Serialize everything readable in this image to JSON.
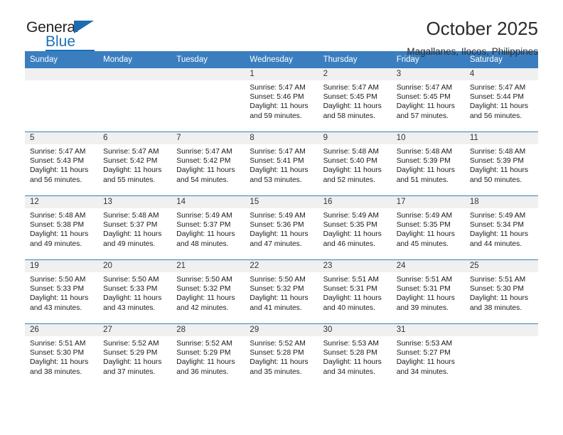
{
  "logo": {
    "word_top": "General",
    "word_bottom": "Blue",
    "triangle_color": "#1d6cb2",
    "text_color": "#231f20",
    "blue_color": "#1d70b8"
  },
  "header": {
    "title": "October 2025",
    "subtitle": "Magallanes, Ilocos, Philippines"
  },
  "theme": {
    "header_bg": "#3a7ebf",
    "header_text": "#ffffff",
    "daynum_bg": "#f0f0f0",
    "cell_bg": "#ffffff",
    "rule_color": "#3a7ebf"
  },
  "weekday_headers": [
    "Sunday",
    "Monday",
    "Tuesday",
    "Wednesday",
    "Thursday",
    "Friday",
    "Saturday"
  ],
  "weeks": [
    [
      {
        "day": "",
        "sunrise": "",
        "sunset": "",
        "daylight": "",
        "empty": true
      },
      {
        "day": "",
        "sunrise": "",
        "sunset": "",
        "daylight": "",
        "empty": true
      },
      {
        "day": "",
        "sunrise": "",
        "sunset": "",
        "daylight": "",
        "empty": true
      },
      {
        "day": "1",
        "sunrise": "Sunrise: 5:47 AM",
        "sunset": "Sunset: 5:46 PM",
        "daylight": "Daylight: 11 hours and 59 minutes."
      },
      {
        "day": "2",
        "sunrise": "Sunrise: 5:47 AM",
        "sunset": "Sunset: 5:45 PM",
        "daylight": "Daylight: 11 hours and 58 minutes."
      },
      {
        "day": "3",
        "sunrise": "Sunrise: 5:47 AM",
        "sunset": "Sunset: 5:45 PM",
        "daylight": "Daylight: 11 hours and 57 minutes."
      },
      {
        "day": "4",
        "sunrise": "Sunrise: 5:47 AM",
        "sunset": "Sunset: 5:44 PM",
        "daylight": "Daylight: 11 hours and 56 minutes."
      }
    ],
    [
      {
        "day": "5",
        "sunrise": "Sunrise: 5:47 AM",
        "sunset": "Sunset: 5:43 PM",
        "daylight": "Daylight: 11 hours and 56 minutes."
      },
      {
        "day": "6",
        "sunrise": "Sunrise: 5:47 AM",
        "sunset": "Sunset: 5:42 PM",
        "daylight": "Daylight: 11 hours and 55 minutes."
      },
      {
        "day": "7",
        "sunrise": "Sunrise: 5:47 AM",
        "sunset": "Sunset: 5:42 PM",
        "daylight": "Daylight: 11 hours and 54 minutes."
      },
      {
        "day": "8",
        "sunrise": "Sunrise: 5:47 AM",
        "sunset": "Sunset: 5:41 PM",
        "daylight": "Daylight: 11 hours and 53 minutes."
      },
      {
        "day": "9",
        "sunrise": "Sunrise: 5:48 AM",
        "sunset": "Sunset: 5:40 PM",
        "daylight": "Daylight: 11 hours and 52 minutes."
      },
      {
        "day": "10",
        "sunrise": "Sunrise: 5:48 AM",
        "sunset": "Sunset: 5:39 PM",
        "daylight": "Daylight: 11 hours and 51 minutes."
      },
      {
        "day": "11",
        "sunrise": "Sunrise: 5:48 AM",
        "sunset": "Sunset: 5:39 PM",
        "daylight": "Daylight: 11 hours and 50 minutes."
      }
    ],
    [
      {
        "day": "12",
        "sunrise": "Sunrise: 5:48 AM",
        "sunset": "Sunset: 5:38 PM",
        "daylight": "Daylight: 11 hours and 49 minutes."
      },
      {
        "day": "13",
        "sunrise": "Sunrise: 5:48 AM",
        "sunset": "Sunset: 5:37 PM",
        "daylight": "Daylight: 11 hours and 49 minutes."
      },
      {
        "day": "14",
        "sunrise": "Sunrise: 5:49 AM",
        "sunset": "Sunset: 5:37 PM",
        "daylight": "Daylight: 11 hours and 48 minutes."
      },
      {
        "day": "15",
        "sunrise": "Sunrise: 5:49 AM",
        "sunset": "Sunset: 5:36 PM",
        "daylight": "Daylight: 11 hours and 47 minutes."
      },
      {
        "day": "16",
        "sunrise": "Sunrise: 5:49 AM",
        "sunset": "Sunset: 5:35 PM",
        "daylight": "Daylight: 11 hours and 46 minutes."
      },
      {
        "day": "17",
        "sunrise": "Sunrise: 5:49 AM",
        "sunset": "Sunset: 5:35 PM",
        "daylight": "Daylight: 11 hours and 45 minutes."
      },
      {
        "day": "18",
        "sunrise": "Sunrise: 5:49 AM",
        "sunset": "Sunset: 5:34 PM",
        "daylight": "Daylight: 11 hours and 44 minutes."
      }
    ],
    [
      {
        "day": "19",
        "sunrise": "Sunrise: 5:50 AM",
        "sunset": "Sunset: 5:33 PM",
        "daylight": "Daylight: 11 hours and 43 minutes."
      },
      {
        "day": "20",
        "sunrise": "Sunrise: 5:50 AM",
        "sunset": "Sunset: 5:33 PM",
        "daylight": "Daylight: 11 hours and 43 minutes."
      },
      {
        "day": "21",
        "sunrise": "Sunrise: 5:50 AM",
        "sunset": "Sunset: 5:32 PM",
        "daylight": "Daylight: 11 hours and 42 minutes."
      },
      {
        "day": "22",
        "sunrise": "Sunrise: 5:50 AM",
        "sunset": "Sunset: 5:32 PM",
        "daylight": "Daylight: 11 hours and 41 minutes."
      },
      {
        "day": "23",
        "sunrise": "Sunrise: 5:51 AM",
        "sunset": "Sunset: 5:31 PM",
        "daylight": "Daylight: 11 hours and 40 minutes."
      },
      {
        "day": "24",
        "sunrise": "Sunrise: 5:51 AM",
        "sunset": "Sunset: 5:31 PM",
        "daylight": "Daylight: 11 hours and 39 minutes."
      },
      {
        "day": "25",
        "sunrise": "Sunrise: 5:51 AM",
        "sunset": "Sunset: 5:30 PM",
        "daylight": "Daylight: 11 hours and 38 minutes."
      }
    ],
    [
      {
        "day": "26",
        "sunrise": "Sunrise: 5:51 AM",
        "sunset": "Sunset: 5:30 PM",
        "daylight": "Daylight: 11 hours and 38 minutes."
      },
      {
        "day": "27",
        "sunrise": "Sunrise: 5:52 AM",
        "sunset": "Sunset: 5:29 PM",
        "daylight": "Daylight: 11 hours and 37 minutes."
      },
      {
        "day": "28",
        "sunrise": "Sunrise: 5:52 AM",
        "sunset": "Sunset: 5:29 PM",
        "daylight": "Daylight: 11 hours and 36 minutes."
      },
      {
        "day": "29",
        "sunrise": "Sunrise: 5:52 AM",
        "sunset": "Sunset: 5:28 PM",
        "daylight": "Daylight: 11 hours and 35 minutes."
      },
      {
        "day": "30",
        "sunrise": "Sunrise: 5:53 AM",
        "sunset": "Sunset: 5:28 PM",
        "daylight": "Daylight: 11 hours and 34 minutes."
      },
      {
        "day": "31",
        "sunrise": "Sunrise: 5:53 AM",
        "sunset": "Sunset: 5:27 PM",
        "daylight": "Daylight: 11 hours and 34 minutes."
      },
      {
        "day": "",
        "sunrise": "",
        "sunset": "",
        "daylight": "",
        "empty": true
      }
    ]
  ]
}
